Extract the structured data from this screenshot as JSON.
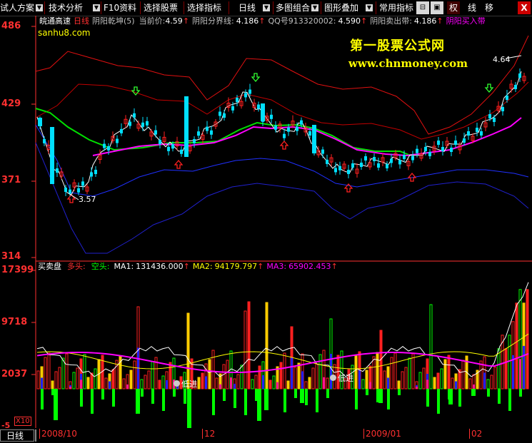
{
  "menu": {
    "items": [
      "试人方案",
      "技术分析",
      "F10资料",
      "选择股票",
      "选择指标",
      "日线",
      "多图组合",
      "图形叠加",
      "常用指标"
    ],
    "icons": [
      "lock-icon",
      "chip-icon"
    ],
    "tabs": [
      "权",
      "线",
      "移"
    ],
    "close": "X"
  },
  "price_axis": {
    "labels": [
      "486",
      "429",
      "371",
      "314"
    ]
  },
  "volume_axis": {
    "labels": [
      "17399",
      "9718",
      "2037",
      "-5"
    ],
    "multiplier": "X10"
  },
  "info_line": {
    "stock": "皖通高速",
    "period": "日线",
    "indicator": "阴阳乾坤(5)",
    "current_label": "当前价:",
    "current_value": "4.59",
    "boundary_label": "阴阳分界线:",
    "boundary_value": "4.186",
    "qq_label": "QQ号913320002:",
    "qq_value": "4.590",
    "sell_label": "阴阳卖出带:",
    "sell_value": "4.186",
    "buy_label": "阴阳买入带"
  },
  "watermark": {
    "site": "sanhu8.com",
    "title": "第一股票公式网",
    "url": "www.chnmoney.com"
  },
  "annotations": {
    "low": "3.57",
    "high": "4.64"
  },
  "volume_info": {
    "name": "买卖盘",
    "bull": "多头:",
    "bear": "空头:",
    "ma1_label": "MA1:",
    "ma1_value": "131436.000",
    "ma2_label": "MA2:",
    "ma2_value": "94179.797",
    "ma3_label": "MA3:",
    "ma3_value": "65902.453"
  },
  "volume_markers": {
    "first": "低进",
    "second": "低进"
  },
  "bottom": {
    "period": "日线",
    "dates": [
      "2008/10",
      "12",
      "2009/01",
      "02"
    ]
  },
  "colors": {
    "bg": "#000000",
    "accent_red": "#ff3030",
    "bull": "#ff3030",
    "bear": "#00ffff",
    "boundary": "#00ff00",
    "channel_upper": "#ff0000",
    "channel_lower": "#3030ff",
    "ma": "#ff00ff"
  }
}
